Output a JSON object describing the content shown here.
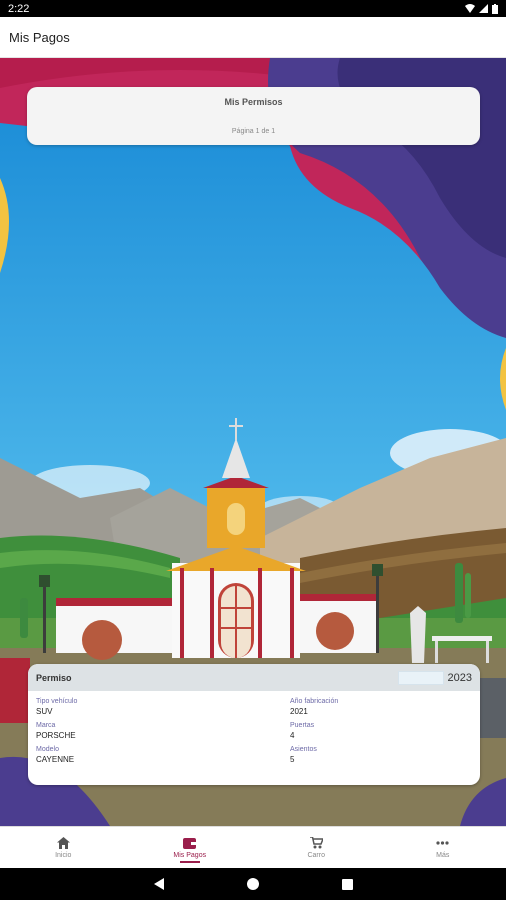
{
  "status_bar": {
    "time": "2:22"
  },
  "app_bar": {
    "title": "Mis Pagos"
  },
  "permisos_card": {
    "title": "Mis Permisos",
    "pagination": "Página 1 de 1"
  },
  "permit": {
    "label": "Permiso",
    "year": "2023",
    "fields": {
      "tipo_label": "Tipo vehículo",
      "tipo_value": "SUV",
      "anio_label": "Año fabricación",
      "anio_value": "2021",
      "marca_label": "Marca",
      "marca_value": "PORSCHE",
      "puertas_label": "Puertas",
      "puertas_value": "4",
      "modelo_label": "Modelo",
      "modelo_value": "CAYENNE",
      "asientos_label": "Asientos",
      "asientos_value": "5"
    }
  },
  "bottom_nav": {
    "inicio": "Inicio",
    "mis_pagos": "Mis Pagos",
    "carro": "Carro",
    "mas": "Más"
  },
  "colors": {
    "accent": "#9a1e4b",
    "sky": "#2b9fe0",
    "purple": "#4b3d8f"
  }
}
